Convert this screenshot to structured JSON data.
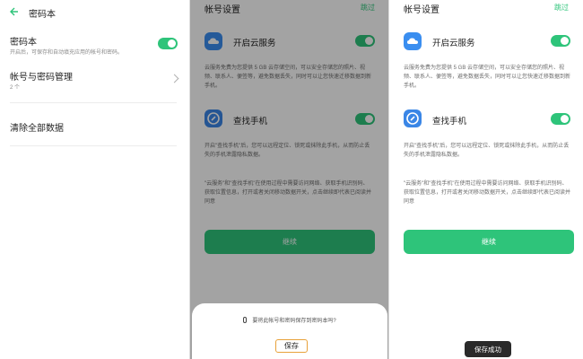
{
  "screen1": {
    "title": "密码本",
    "back_icon": "back-arrow-icon",
    "items": [
      {
        "title": "密码本",
        "subtitle": "开启后，可保存和自动填充应用的帐号和密码。",
        "toggle_on": true
      },
      {
        "title": "帐号与密码管理",
        "subtitle": "2 个"
      },
      {
        "title": "清除全部数据"
      }
    ]
  },
  "screen2": {
    "title": "帐号设置",
    "skip": "跳过",
    "cloud": {
      "title": "开启云服务",
      "toggle_on": true,
      "desc": "云服务免费为您提供 5 GB 云存储空间，可以安全存储您的照片、视频、联系人、便签等，避免数据丢失，同时可以让您快速迁移数据到新手机。"
    },
    "find": {
      "title": "查找手机",
      "toggle_on": true,
      "desc": "开启\"查找手机\"后，您可以远程定位、锁死或抹除此手机，从而防止丢失的手机泄露隐私数据。"
    },
    "notice": "\"云服务\"和\"查找手机\"在使用过程中需要访问网络、获取手机识别码、获取位置信息，打开或者关闭移动数据开关，点击继续即代表已阅读并同意",
    "continue": "继续",
    "sheet": {
      "prompt": "要将此帐号和密码保存到密码本吗?",
      "save": "保存"
    }
  },
  "screen3": {
    "title": "帐号设置",
    "skip": "跳过",
    "cloud": {
      "title": "开启云服务",
      "toggle_on": true,
      "desc": "云服务免费为您提供 5 GB 云存储空间，可以安全存储您的照片、视频、联系人、便签等，避免数据丢失，同时可以让您快速迁移数据到新手机。"
    },
    "find": {
      "title": "查找手机",
      "toggle_on": true,
      "desc": "开启\"查找手机\"后，您可以远程定位、锁死或抹除此手机，从而防止丢失的手机泄露隐私数据。"
    },
    "notice": "\"云服务\"和\"查找手机\"在使用过程中需要访问网络、获取手机识别码、获取位置信息，打开或者关闭移动数据开关，点击继续即代表已阅读并同意",
    "continue": "继续",
    "toast": "保存成功"
  },
  "colors": {
    "accent": "#2ec47a",
    "cloud_icon": "#3a8ef0",
    "find_icon": "#3a86e6",
    "save_border": "#e8a23a"
  }
}
